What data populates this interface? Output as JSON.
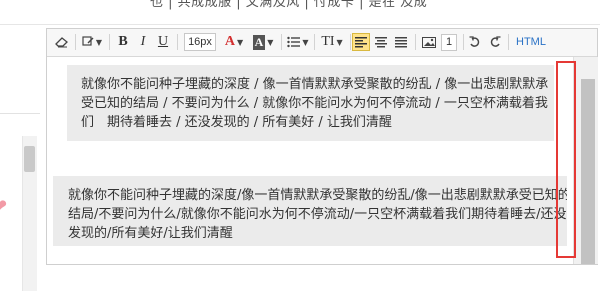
{
  "top_fragment": "也  | 共成成服  |  文满及风  |  忖成卡  |  是在   及成",
  "toolbar": {
    "eraser_icon": "eraser-icon",
    "brush_icon": "format-brush-icon",
    "bold_label": "B",
    "italic_label": "I",
    "underline_label": "U",
    "font_size": "16px",
    "font_color_label": "A",
    "bg_color_label": "A",
    "list_icon": "list-icon",
    "heading_label": "TI",
    "image_count": "1",
    "html_label": "HTML",
    "colors": {
      "font_color": "#d32f2f",
      "active_bg": "#ffe38a",
      "html_link": "#2a72c6"
    }
  },
  "content": {
    "paragraph1": "就像你不能问种子埋藏的深度 / 像一首情默默承受聚散的纷乱 / 像一出悲剧默默承受已知的结局 / 不要问为什么 / 就像你不能问水为何不停流动 / 一只空杯满载着我们　期待着睡去 / 还没发现的 / 所有美好 / 让我们清醒",
    "paragraph2": "就像你不能问种子埋藏的深度/像一首情默默承受聚散的纷乱/像一出悲剧默默承受已知的结局/不要问为什么/就像你不能问水为何不停流动/一只空杯满载着我们期待着睡去/还没发现的/所有美好/让我们清醒"
  },
  "highlight_color": "#e53935"
}
